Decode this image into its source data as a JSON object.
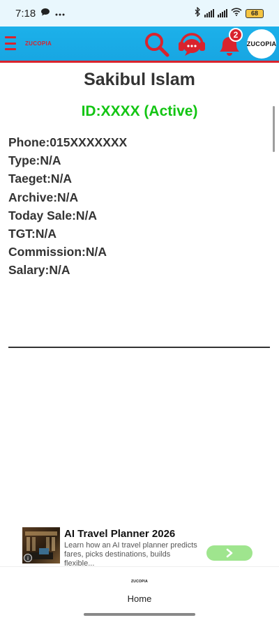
{
  "statusbar": {
    "time": "7:18",
    "battery": "68"
  },
  "header": {
    "brand": "ZUCOPIA",
    "notification_count": "2",
    "logo_text": "ZUCOPIA"
  },
  "profile": {
    "name": "Sakibul Islam",
    "id_line": "ID:XXXX (Active)",
    "fields": [
      "Phone:015XXXXXXX",
      "Type:N/A",
      "Taeget:N/A",
      "Archive:N/A",
      "Today Sale:N/A",
      "TGT:N/A",
      "Commission:N/A",
      "Salary:N/A"
    ]
  },
  "ad": {
    "title": "AI Travel Planner 2026",
    "description": "Learn how an AI travel planner predicts fares, picks destinations, builds flexible..."
  },
  "bottomnav": {
    "logo_text": "ZUCOPIA",
    "home_label": "Home"
  },
  "colors": {
    "header_bg": "#1cb1ea",
    "accent_red": "#d9232d",
    "status_green": "#13c513"
  }
}
